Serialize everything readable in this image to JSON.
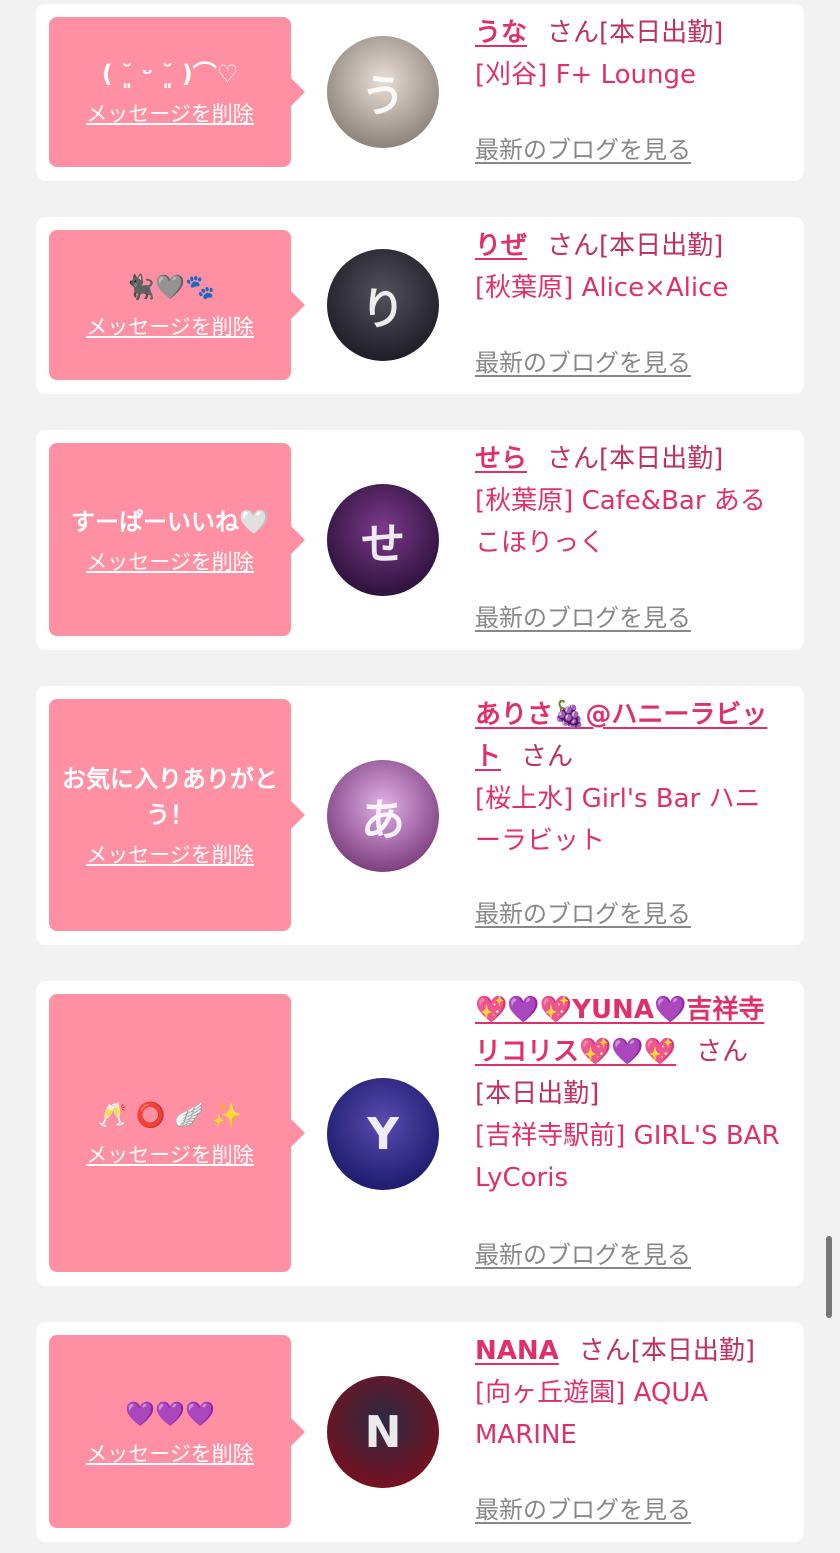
{
  "messages": [
    {
      "bubble_text": "( ˘͈ ᵕ ˘͈ )⌒♡",
      "delete_label": "メッセージを削除",
      "cast_name": "うな",
      "honorific": "さん",
      "status": "[本日出勤]",
      "area": "[刈谷]",
      "shop": "F+ Lounge",
      "blog_label": "最新のブログを見る",
      "avatar_initial": "う",
      "avatar_colors": [
        "#8a7f76",
        "#e9dfd6"
      ]
    },
    {
      "bubble_text": "🐈‍⬛🩶🐾",
      "delete_label": "メッセージを削除",
      "cast_name": "りぜ",
      "honorific": "さん",
      "status": "[本日出勤]",
      "area": "[秋葉原]",
      "shop": "Alice×Alice",
      "blog_label": "最新のブログを見る",
      "avatar_initial": "り",
      "avatar_colors": [
        "#1c1c26",
        "#53505a"
      ]
    },
    {
      "bubble_text": "すーぱーいいね🤍",
      "delete_label": "メッセージを削除",
      "cast_name": "せら",
      "honorific": "さん",
      "status": "[本日出勤]",
      "area": "[秋葉原]",
      "shop": "Cafe&Bar あるこほりっく",
      "blog_label": "最新のブログを見る",
      "avatar_initial": "せ",
      "avatar_colors": [
        "#2a1038",
        "#7b3a8a"
      ]
    },
    {
      "bubble_text": "お気に入りありがとう！",
      "delete_label": "メッセージを削除",
      "cast_name": "ありさ🍇@ハニーラビット",
      "honorific": "さん",
      "status": "",
      "area": "[桜上水]",
      "shop": "Girl's Bar ハニーラビット",
      "blog_label": "最新のブログを見る",
      "avatar_initial": "あ",
      "avatar_colors": [
        "#7a3a7a",
        "#e0b0e8"
      ]
    },
    {
      "bubble_text": "🥂 ⭕ 🪽 ✨",
      "delete_label": "メッセージを削除",
      "cast_name": "💖💜💖YUNA💜吉祥寺リコリス💖💜💖",
      "honorific": "さん",
      "status": "[本日出勤]",
      "area": "[吉祥寺駅前]",
      "shop": "GIRL'S BAR LyCoris",
      "blog_label": "最新のブログを見る",
      "avatar_initial": "Y",
      "avatar_colors": [
        "#1a1a6a",
        "#5a4ab0"
      ]
    },
    {
      "bubble_text": "💜💜💜",
      "delete_label": "メッセージを削除",
      "cast_name": "NANA",
      "honorific": "さん",
      "status": "[本日出勤]",
      "area": "[向ヶ丘遊園]",
      "shop": "AQUA MARINE",
      "blog_label": "最新のブログを見る",
      "avatar_initial": "N",
      "avatar_colors": [
        "#7a1020",
        "#2a2a40"
      ]
    }
  ]
}
